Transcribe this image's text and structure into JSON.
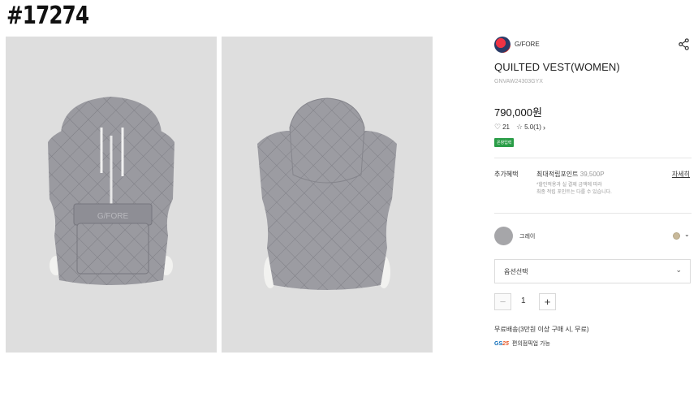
{
  "watermark": "#17274",
  "gallery": {
    "front_logo_text": "G/FORE"
  },
  "brand": {
    "name": "G/FORE"
  },
  "product": {
    "title": "QUILTED VEST(WOMEN)",
    "code": "GNVAW24303GYX",
    "price": "790,000원",
    "likes": "21",
    "rating": "5.0(1)",
    "badge": "온창입력"
  },
  "benefit": {
    "label": "추가혜택",
    "title": "최대적립포인트",
    "points": "39,500P",
    "detail_link": "자세히",
    "note_line1": "*할인적용과 실 결제 금액에 따라",
    "note_line2": "최종 적립 포인트는 다를 수 있습니다."
  },
  "color": {
    "name": "그레이",
    "swatch_hex": "#a6a6a9",
    "selected_dot_hex": "#c8b99a"
  },
  "option_select": {
    "label": "옵션선택"
  },
  "quantity": {
    "minus": "−",
    "value": "1",
    "plus": "+"
  },
  "shipping": {
    "text": "무료배송(3만원 이상 구매 시, 무료)",
    "pickup_logo_a": "GS",
    "pickup_logo_b": "25",
    "pickup_text": "편의점픽업 가능"
  },
  "icons": [
    "share-icon",
    "heart-icon",
    "star-icon",
    "chevron-right-icon",
    "chevron-down-icon"
  ]
}
